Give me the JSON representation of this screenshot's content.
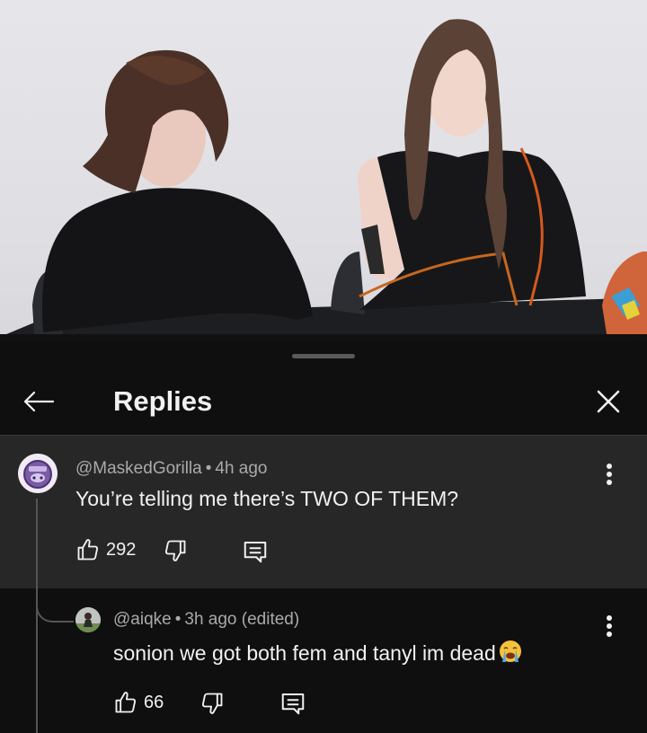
{
  "video": {
    "description_icon": "video-frame"
  },
  "panel": {
    "title": "Replies",
    "back_icon": "arrow-left-icon",
    "close_icon": "close-icon"
  },
  "comments": [
    {
      "author": "@MaskedGorilla",
      "separator": "•",
      "time": "4h ago",
      "text": "You’re telling me there’s TWO OF THEM?",
      "likes": "292",
      "avatar_icon": "masked-gorilla-avatar"
    },
    {
      "author": "@aiqke",
      "separator": "•",
      "time": "3h ago (edited)",
      "text": "sonion we got both fem and tanyl im dead",
      "likes": "66",
      "emoji_icon": "loudly-crying-face-emoji",
      "avatar_icon": "aiqke-avatar"
    }
  ],
  "colors": {
    "background": "#0f0f0f",
    "highlight": "#272727",
    "secondary_text": "#aaaaaa",
    "primary_text": "#f1f1f1"
  }
}
